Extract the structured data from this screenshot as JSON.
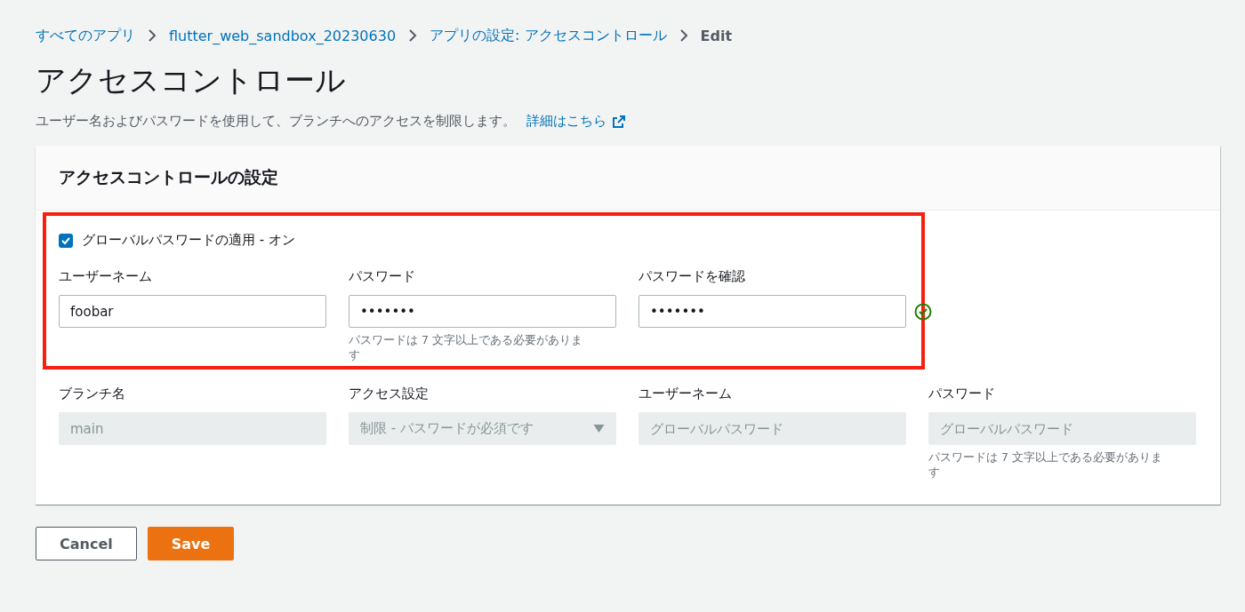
{
  "breadcrumb": [
    {
      "label": "すべてのアプリ",
      "link": true
    },
    {
      "label": "flutter_web_sandbox_20230630",
      "link": true
    },
    {
      "label": "アプリの設定: アクセスコントロール",
      "link": true
    },
    {
      "label": "Edit",
      "link": false
    }
  ],
  "title": "アクセスコントロール",
  "description": "ユーザー名およびパスワードを使用して、ブランチへのアクセスを制限します。",
  "details_link": "詳細はこちら",
  "panel": {
    "title": "アクセスコントロールの設定",
    "global_password": {
      "label": "グローバルパスワードの適用 - オン",
      "checked": true
    },
    "global_fields": [
      {
        "label": "ユーザーネーム",
        "value": "foobar",
        "valid": false
      },
      {
        "label": "パスワード",
        "value": "•••••••",
        "hint": "パスワードは 7 文字以上である必要があります",
        "valid": false
      },
      {
        "label": "パスワードを確認",
        "value": "•••••••",
        "valid": true
      }
    ],
    "branch_fields": [
      {
        "kind": "text",
        "label": "ブランチ名",
        "value": "main"
      },
      {
        "kind": "select",
        "label": "アクセス設定",
        "value": "制限 - パスワードが必須です"
      },
      {
        "kind": "text",
        "label": "ユーザーネーム",
        "placeholder": "グローバルパスワード"
      },
      {
        "kind": "text",
        "label": "パスワード",
        "placeholder": "グローバルパスワード",
        "hint": "パスワードは 7 文字以上である必要があります"
      }
    ]
  },
  "buttons": [
    {
      "label": "Cancel",
      "kind": "secondary"
    },
    {
      "label": "Save",
      "kind": "primary"
    }
  ]
}
